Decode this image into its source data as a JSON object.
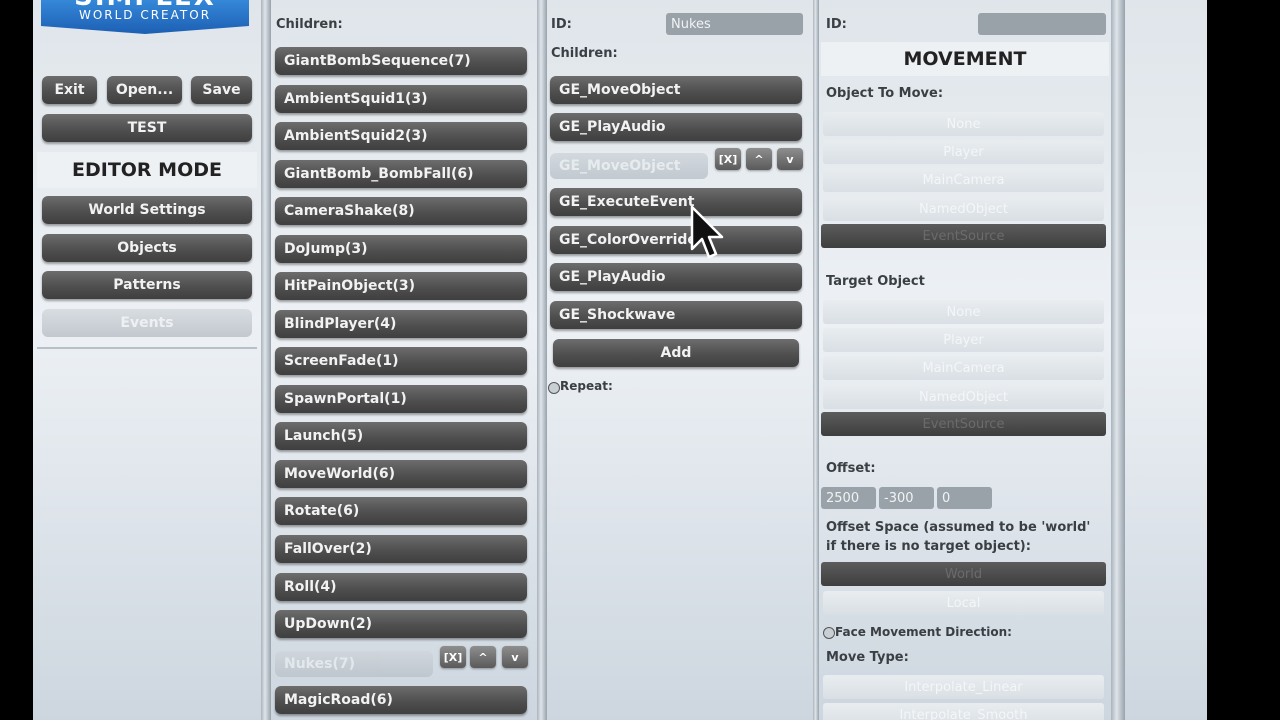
{
  "logo": {
    "title": "SIMPLEX",
    "subtitle": "WORLD CREATOR"
  },
  "toolbar": {
    "exit": "Exit",
    "open": "Open...",
    "save": "Save",
    "test": "TEST"
  },
  "editor_mode": {
    "title": "EDITOR MODE",
    "items": [
      {
        "label": "World Settings",
        "enabled": true
      },
      {
        "label": "Objects",
        "enabled": true
      },
      {
        "label": "Patterns",
        "enabled": true
      },
      {
        "label": "Events",
        "enabled": false
      }
    ]
  },
  "events_panel": {
    "children_label": "Children:",
    "items": [
      "GiantBombSequence(7)",
      "AmbientSquid1(3)",
      "AmbientSquid2(3)",
      "GiantBomb_BombFall(6)",
      "CameraShake(8)",
      "DoJump(3)",
      "HitPainObject(3)",
      "BlindPlayer(4)",
      "ScreenFade(1)",
      "SpawnPortal(1)",
      "Launch(5)",
      "MoveWorld(6)",
      "Rotate(6)",
      "FallOver(2)",
      "Roll(4)",
      "UpDown(2)"
    ],
    "selected_item": "Nukes(7)",
    "after_items": [
      "MagicRoad(6)"
    ],
    "controls": {
      "remove": "[X]",
      "up": "^",
      "down": "v"
    }
  },
  "sequence_panel": {
    "id_label": "ID:",
    "id_value": "Nukes",
    "children_label": "Children:",
    "items": [
      "GE_MoveObject",
      "GE_PlayAudio"
    ],
    "dragging_item": "GE_MoveObject",
    "items_after": [
      "GE_ExecuteEvent",
      "GE_ColorOverride",
      "GE_PlayAudio",
      "GE_Shockwave"
    ],
    "add_label": "Add",
    "repeat_label": "Repeat:",
    "controls": {
      "remove": "[X]",
      "up": "^",
      "down": "v"
    }
  },
  "movement_panel": {
    "id_label": "ID:",
    "title": "MOVEMENT",
    "object_to_move_label": "Object To Move:",
    "object_options": [
      "None",
      "Player",
      "MainCamera",
      "NamedObject",
      "EventSource"
    ],
    "object_selected": "EventSource",
    "target_object_label": "Target Object",
    "target_options": [
      "None",
      "Player",
      "MainCamera",
      "NamedObject",
      "EventSource"
    ],
    "target_selected": "EventSource",
    "offset_label": "Offset:",
    "offset": {
      "x": "2500",
      "y": "-300",
      "z": "0"
    },
    "offset_space_label": "Offset Space (assumed to be 'world' if there is no target object):",
    "space_options": [
      "World",
      "Local"
    ],
    "space_selected": "World",
    "face_direction_label": "Face Movement Direction:",
    "move_type_label": "Move Type:",
    "move_type_options": [
      "Interpolate_Linear",
      "Interpolate_Smooth"
    ]
  }
}
